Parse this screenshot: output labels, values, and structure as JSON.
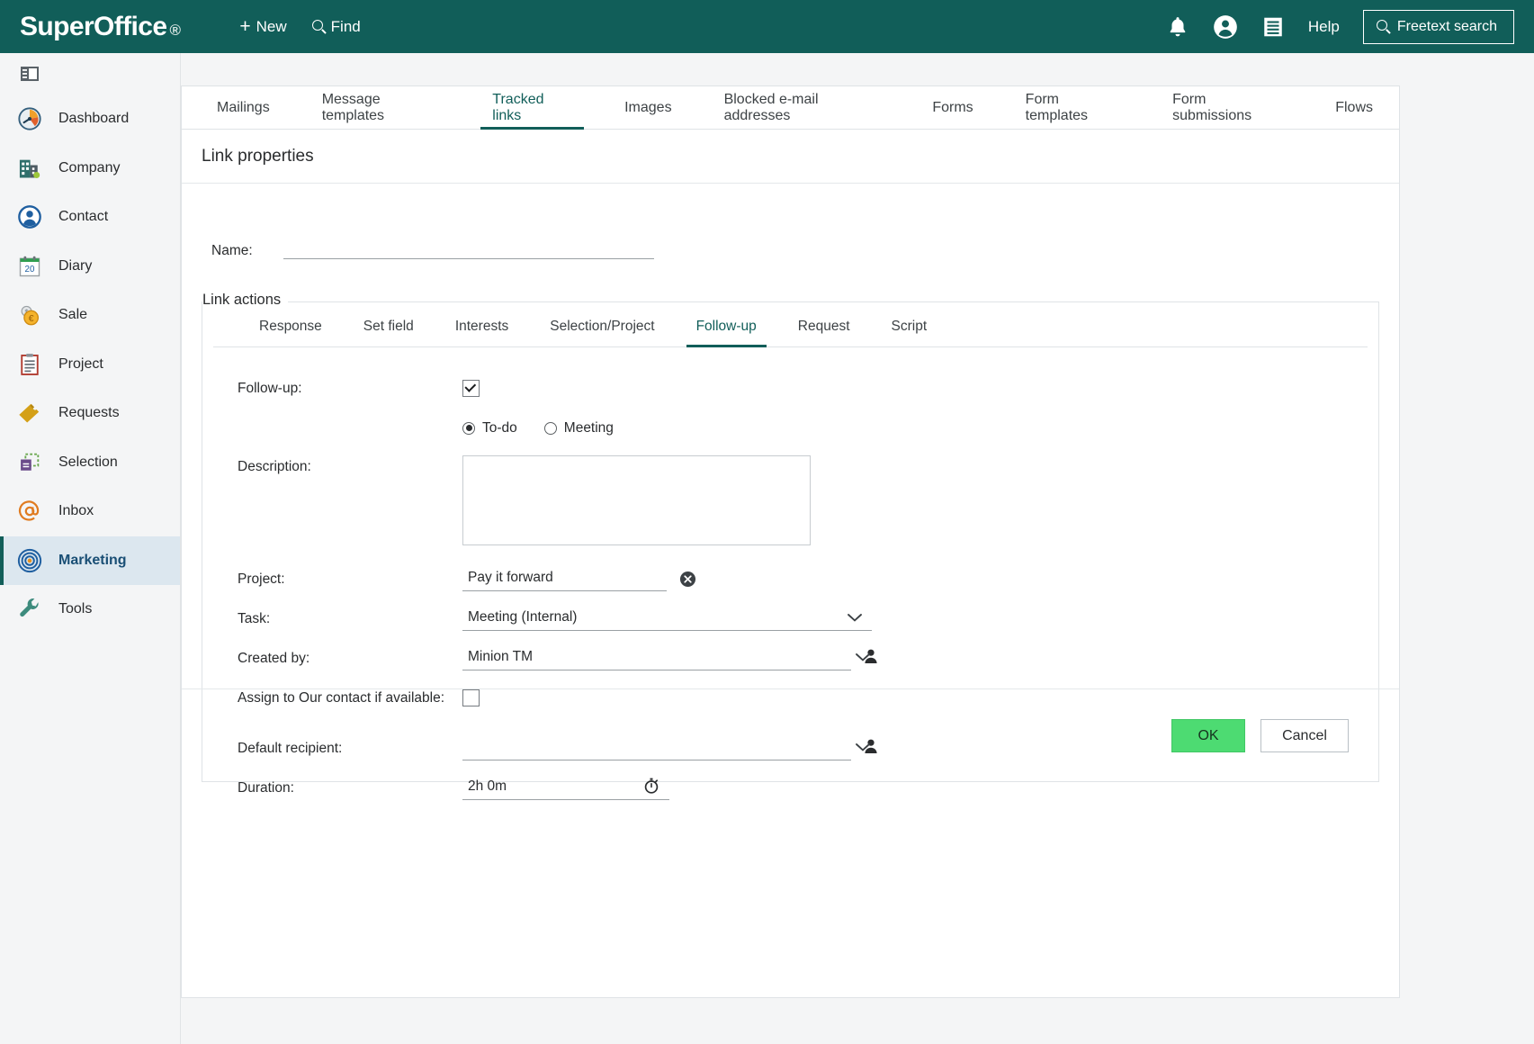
{
  "header": {
    "logo": "SuperOffice",
    "logo_mark": "®",
    "new_label": "New",
    "find_label": "Find",
    "help_label": "Help",
    "freetext_label": "Freetext search",
    "bell_icon": "bell-icon",
    "user_icon": "user-avatar-icon",
    "menu_icon": "hamburger-menu-icon",
    "accent_color": "#115e59"
  },
  "sidebar": {
    "collapse_icon": "panel-collapse-icon",
    "items": [
      {
        "label": "Dashboard",
        "icon": "gauge-icon",
        "active": false
      },
      {
        "label": "Company",
        "icon": "building-icon",
        "active": false
      },
      {
        "label": "Contact",
        "icon": "person-circle-icon",
        "active": false
      },
      {
        "label": "Diary",
        "icon": "calendar-icon",
        "active": false
      },
      {
        "label": "Sale",
        "icon": "coins-icon",
        "active": false
      },
      {
        "label": "Project",
        "icon": "clipboard-icon",
        "active": false
      },
      {
        "label": "Requests",
        "icon": "ticket-icon",
        "active": false
      },
      {
        "label": "Selection",
        "icon": "selection-icon",
        "active": false
      },
      {
        "label": "Inbox",
        "icon": "at-sign-icon",
        "active": false
      },
      {
        "label": "Marketing",
        "icon": "target-icon",
        "active": true
      },
      {
        "label": "Tools",
        "icon": "wrench-icon",
        "active": false
      }
    ],
    "diary_day": "20",
    "highlight_bg": "#dce7ef",
    "highlight_text": "#1a4f75"
  },
  "tabs": [
    {
      "label": "Mailings",
      "active": false
    },
    {
      "label": "Message templates",
      "active": false
    },
    {
      "label": "Tracked links",
      "active": true
    },
    {
      "label": "Images",
      "active": false
    },
    {
      "label": "Blocked e-mail addresses",
      "active": false
    },
    {
      "label": "Forms",
      "active": false
    },
    {
      "label": "Form templates",
      "active": false
    },
    {
      "label": "Form submissions",
      "active": false
    },
    {
      "label": "Flows",
      "active": false
    }
  ],
  "page": {
    "title": "Link properties",
    "name_label": "Name:",
    "name_value": "",
    "name_placeholder": ""
  },
  "link_actions": {
    "legend": "Link actions",
    "subtabs": [
      {
        "label": "Response",
        "active": false
      },
      {
        "label": "Set field",
        "active": false
      },
      {
        "label": "Interests",
        "active": false
      },
      {
        "label": "Selection/Project",
        "active": false
      },
      {
        "label": "Follow-up",
        "active": true
      },
      {
        "label": "Request",
        "active": false
      },
      {
        "label": "Script",
        "active": false
      }
    ]
  },
  "form": {
    "followup_label": "Follow-up:",
    "followup_checked": true,
    "type_options": [
      {
        "label": "To-do",
        "selected": true
      },
      {
        "label": "Meeting",
        "selected": false
      }
    ],
    "description_label": "Description:",
    "description_value": "",
    "project_label": "Project:",
    "project_value": "Pay it forward",
    "project_clear_icon": "clear-circle-x-icon",
    "task_label": "Task:",
    "task_value": "Meeting (Internal)",
    "task_chevron_icon": "chevron-down-icon",
    "created_by_label": "Created by:",
    "created_by_value": "Minion TM",
    "created_by_chevron_icon": "chevron-down-icon",
    "created_by_person_icon": "person-picker-icon",
    "assign_label": "Assign to Our contact if available:",
    "assign_checked": false,
    "recipient_label": "Default recipient:",
    "recipient_value": "",
    "recipient_chevron_icon": "chevron-down-icon",
    "recipient_person_icon": "person-picker-icon",
    "duration_label": "Duration:",
    "duration_value": "2h 0m",
    "duration_icon": "stopwatch-icon"
  },
  "footer": {
    "ok_label": "OK",
    "cancel_label": "Cancel",
    "ok_color": "#4ddb72"
  }
}
